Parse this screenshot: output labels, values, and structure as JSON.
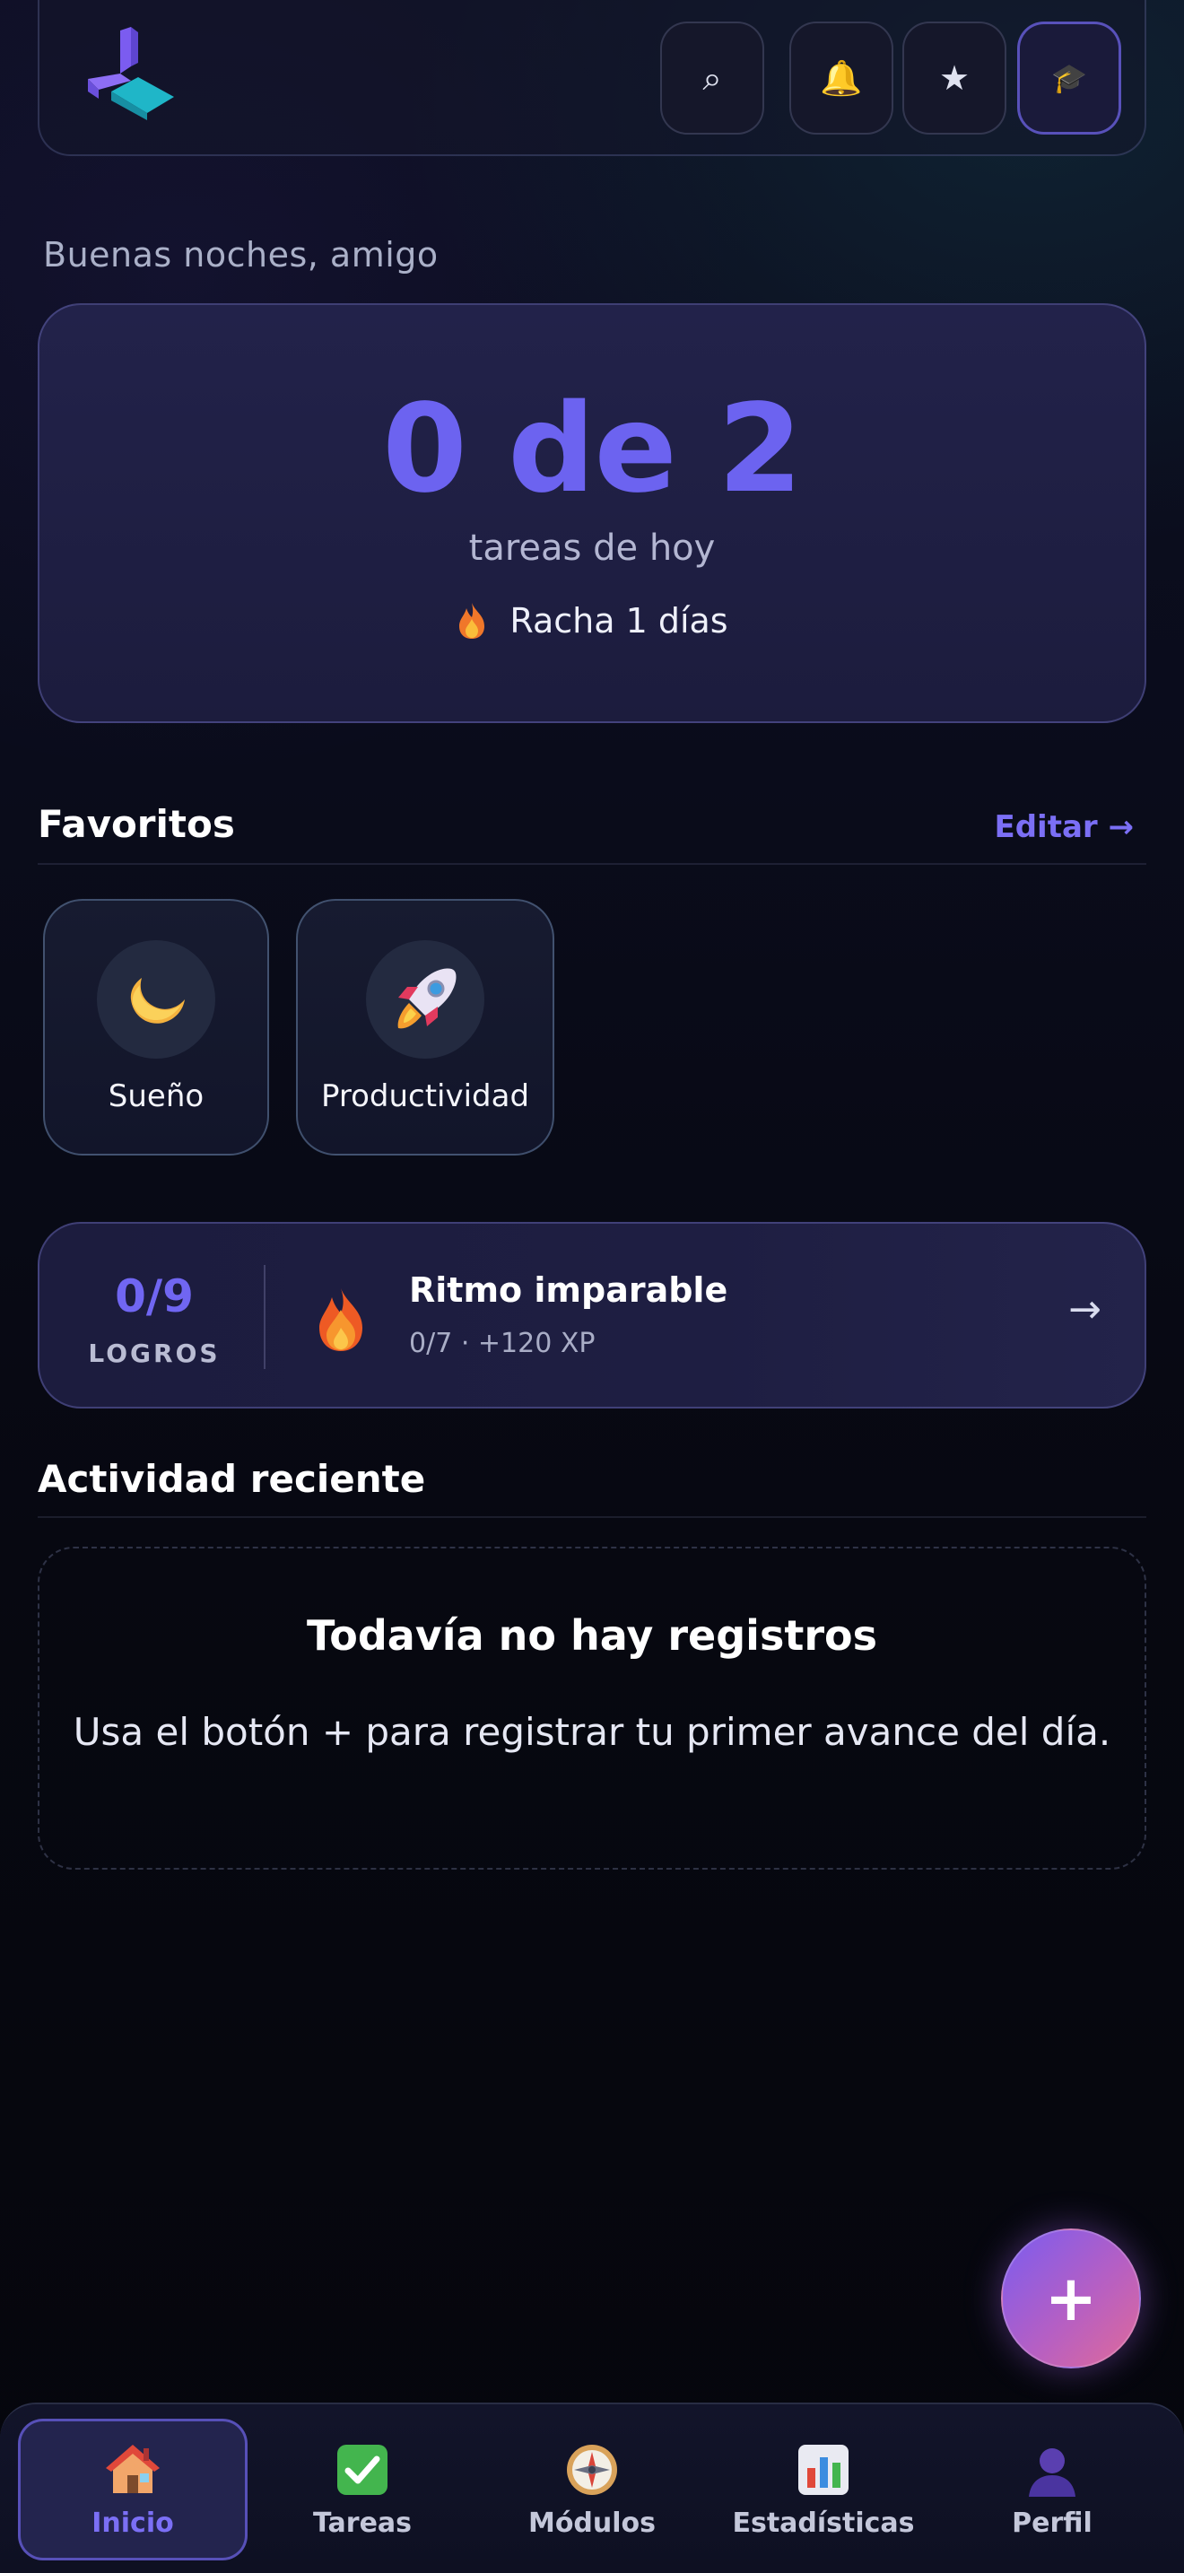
{
  "header": {
    "logo": "logo-icon",
    "buttons": [
      {
        "icon": "search-icon",
        "glyph": "⌕"
      },
      {
        "icon": "bell-icon",
        "glyph": "🔔"
      },
      {
        "icon": "star-icon",
        "glyph": "★"
      },
      {
        "icon": "graduation-cap-icon",
        "glyph": "🎓"
      }
    ]
  },
  "greeting": "Buenas noches, amigo",
  "hero": {
    "count": "0 de 2",
    "label": "tareas de hoy",
    "streak": "Racha 1 días"
  },
  "favorites": {
    "title": "Favoritos",
    "edit_label": "Editar →",
    "items": [
      {
        "label": "Sueño",
        "icon": "moon-icon"
      },
      {
        "label": "Productividad",
        "icon": "rocket-icon"
      }
    ]
  },
  "achievements": {
    "count": "0/9",
    "label": "LOGROS",
    "title": "Ritmo imparable",
    "subtitle": "0/7 · +120 XP",
    "arrow": "→"
  },
  "activity": {
    "title": "Actividad reciente",
    "empty_title": "Todavía no hay registros",
    "empty_text": "Usa el botón + para registrar tu primer avance del día."
  },
  "fab": {
    "label": "+"
  },
  "nav": {
    "items": [
      {
        "label": "Inicio",
        "icon": "house-icon",
        "active": true
      },
      {
        "label": "Tareas",
        "icon": "check-box-icon",
        "active": false
      },
      {
        "label": "Módulos",
        "icon": "compass-icon",
        "active": false
      },
      {
        "label": "Estadísticas",
        "icon": "bar-chart-icon",
        "active": false
      },
      {
        "label": "Perfil",
        "icon": "user-icon",
        "active": false
      }
    ]
  },
  "colors": {
    "accent": "#6c63f0",
    "background": "#06070f",
    "card": "#1f1f44"
  }
}
